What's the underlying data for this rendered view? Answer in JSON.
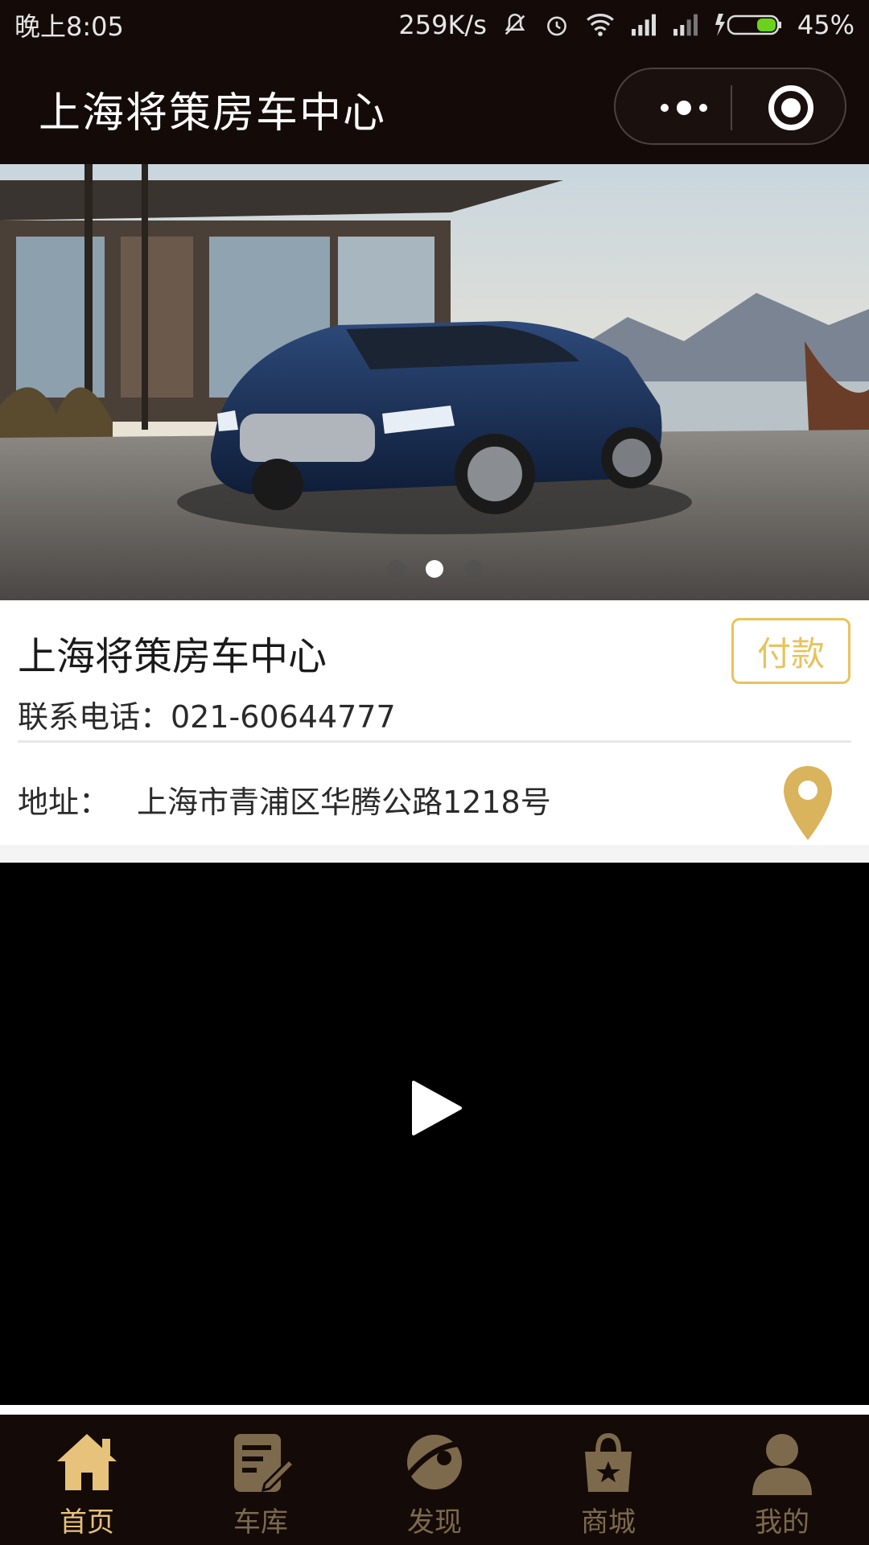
{
  "status_bar": {
    "time": "晚上8:05",
    "network_speed": "259K/s",
    "battery": "45%"
  },
  "nav": {
    "title": "上海将策房车中心"
  },
  "banner": {
    "slide_count": 3,
    "active_index": 1
  },
  "info": {
    "shop_name": "上海将策房车中心",
    "pay_label": "付款",
    "phone": "联系电话：021-60644777",
    "address_label": "地址：",
    "address_value": "上海市青浦区华腾公路1218号"
  },
  "tabs": [
    {
      "label": "首页",
      "icon": "home-icon",
      "active": true
    },
    {
      "label": "车库",
      "icon": "edit-icon",
      "active": false
    },
    {
      "label": "发现",
      "icon": "discover-icon",
      "active": false
    },
    {
      "label": "商城",
      "icon": "shop-bag-icon",
      "active": false
    },
    {
      "label": "我的",
      "icon": "user-icon",
      "active": false
    }
  ],
  "colors": {
    "bar_bg": "#140b08",
    "accent_gold": "#e8c35c",
    "tab_active": "#e7c27a",
    "tab_inactive": "#7d6a4c"
  }
}
